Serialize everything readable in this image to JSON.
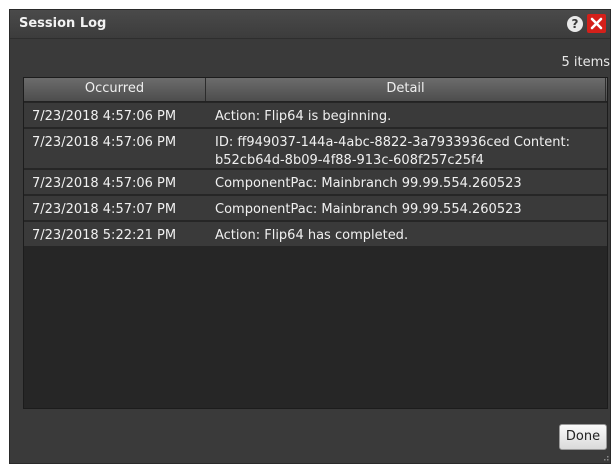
{
  "window": {
    "title": "Session Log",
    "help_label": "?"
  },
  "summary": {
    "count_text": "5 items"
  },
  "table": {
    "headers": [
      "Occurred",
      "Detail"
    ],
    "rows": [
      {
        "occurred": "7/23/2018 4:57:06 PM",
        "detail": "Action: Flip64 is beginning."
      },
      {
        "occurred": "7/23/2018 4:57:06 PM",
        "detail": "ID: ff949037-144a-4abc-8822-3a7933936ced  Content: b52cb64d-8b09-4f88-913c-608f257c25f4"
      },
      {
        "occurred": "7/23/2018 4:57:06 PM",
        "detail": "ComponentPac: Mainbranch 99.99.554.260523"
      },
      {
        "occurred": "7/23/2018 4:57:07 PM",
        "detail": "ComponentPac: Mainbranch 99.99.554.260523"
      },
      {
        "occurred": "7/23/2018 5:22:21 PM",
        "detail": "Action: Flip64 has completed."
      }
    ]
  },
  "footer": {
    "done_label": "Done"
  },
  "colors": {
    "window_bg": "#3a3a3a",
    "table_bg": "#262626",
    "close_red": "#d4201a"
  },
  "icons": {
    "help": "help-icon",
    "close": "close-icon",
    "resize": "resize-grip-icon"
  }
}
